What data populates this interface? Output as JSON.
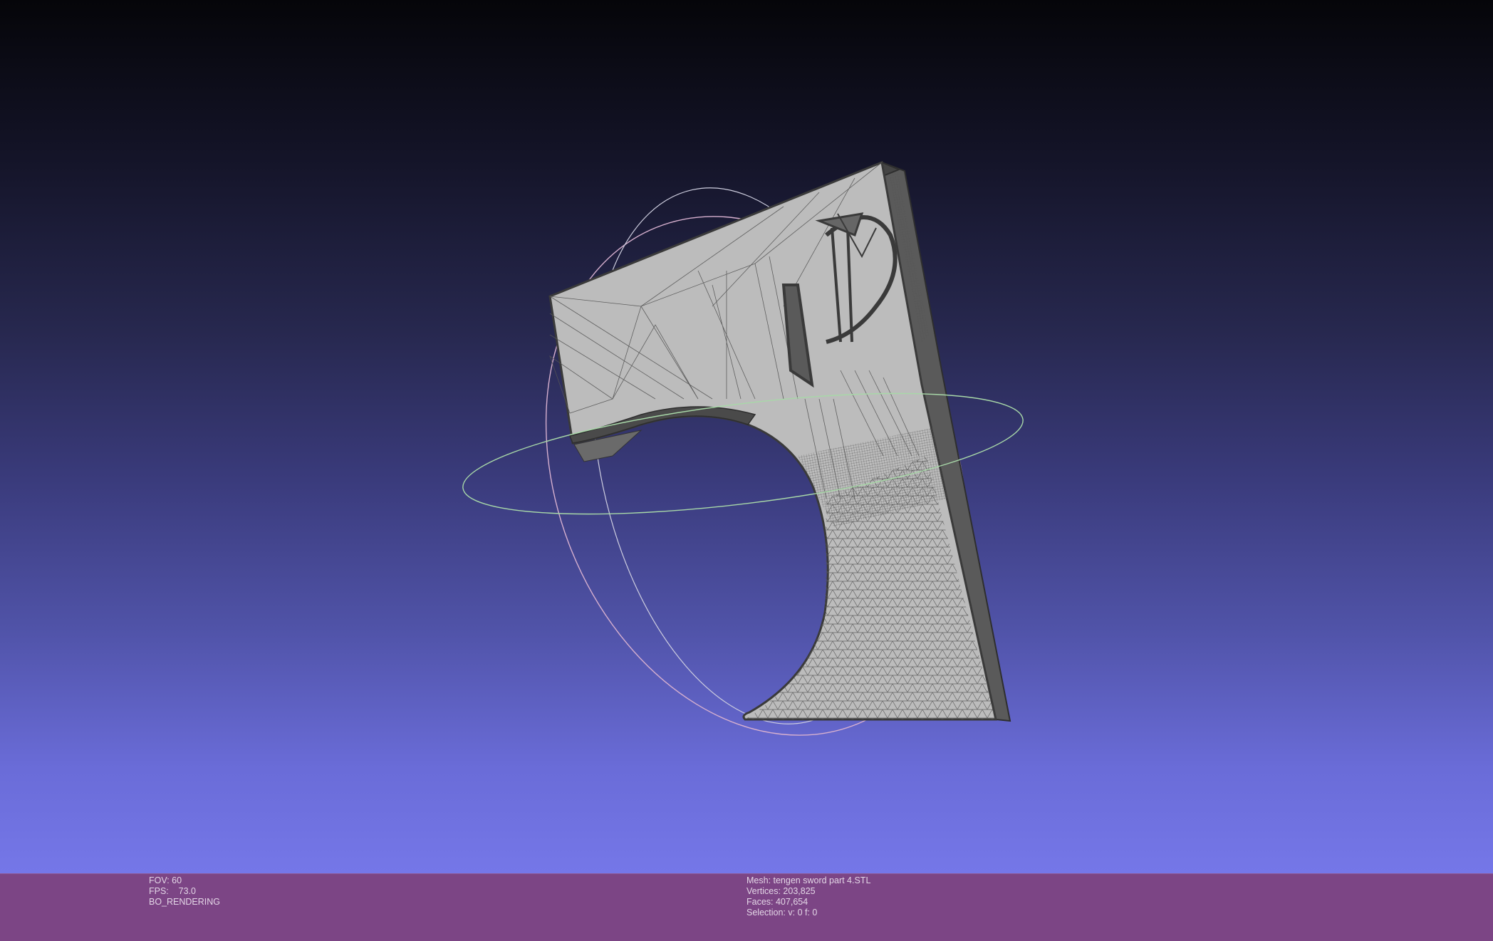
{
  "viewer": {
    "background_top": "#050509",
    "background_bottom": "#7577e8",
    "mesh_fill": "#bebebe",
    "mesh_edge": "#4a4a4a",
    "trackball_colors": [
      "#d9a8c8",
      "#a8d8a8",
      "#c8c8d8"
    ]
  },
  "status_bar": {
    "color": "#7c4585",
    "left": {
      "fov": "FOV: 60",
      "fps": "FPS:    73.0",
      "mode": "BO_RENDERING"
    },
    "right": {
      "mesh": "Mesh: tengen sword part 4.STL",
      "vertices": "Vertices: 203,825",
      "faces": "Faces: 407,654",
      "selection": "Selection: v: 0 f: 0"
    }
  }
}
